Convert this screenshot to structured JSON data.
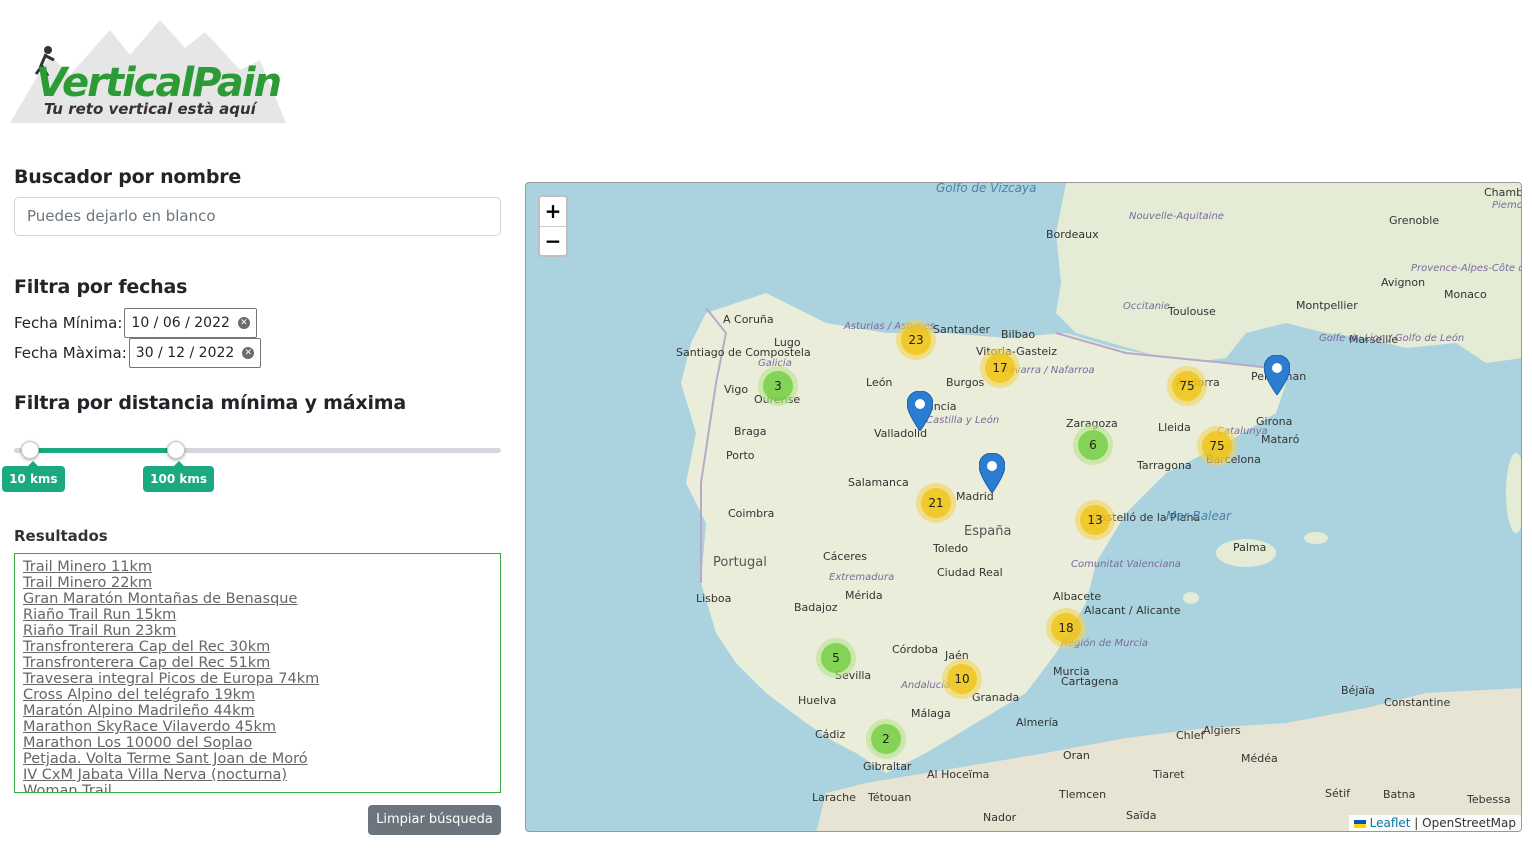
{
  "logo": {
    "brand": "VerticalPain",
    "tagline": "Tu reto vertical està aquí"
  },
  "search": {
    "title": "Buscador por nombre",
    "placeholder": "Puedes dejarlo en blanco"
  },
  "dates": {
    "title": "Filtra por fechas",
    "min_label": "Fecha Mínima:",
    "min_value": "10 / 06 / 2022",
    "max_label": "Fecha Màxima:",
    "max_value": "30 / 12 / 2022"
  },
  "distance": {
    "title": "Filtra por distancia mínima y máxima",
    "min_label": "10 kms",
    "max_label": "100 kms",
    "min_fraction": 0.033,
    "max_fraction": 0.333
  },
  "results": {
    "title": "Resultados",
    "items": [
      "Trail Minero 11km",
      "Trail Minero 22km",
      "Gran Maratón Montañas de Benasque",
      "Riaño Trail Run 15km",
      "Riaño Trail Run 23km",
      "Transfronterera Cap del Rec 30km",
      "Transfronterera Cap del Rec 51km",
      "Travesera integral Picos de Europa 74km",
      "Cross Alpino del telégrafo 19km",
      "Maratón Alpino Madrileño 44km",
      "Marathon SkyRace Vilaverdo 45km",
      "Marathon Los 10000 del Soplao",
      "Petjada. Volta Terme Sant Joan de Moró",
      "IV CxM Jabata Villa Nerva (nocturna)",
      "Woman Trail"
    ],
    "clear_label": "Limpiar búsqueda"
  },
  "map": {
    "zoom_in": "+",
    "zoom_out": "−",
    "attribution_leaflet": "Leaflet",
    "attribution_osm": "| OpenStreetMap",
    "clusters": [
      {
        "count": "23",
        "color": "yellow"
      },
      {
        "count": "17",
        "color": "yellow"
      },
      {
        "count": "3",
        "color": "green"
      },
      {
        "count": "75",
        "color": "yellow"
      },
      {
        "count": "75",
        "color": "yellow"
      },
      {
        "count": "6",
        "color": "green"
      },
      {
        "count": "21",
        "color": "yellow"
      },
      {
        "count": "13",
        "color": "yellow"
      },
      {
        "count": "18",
        "color": "yellow"
      },
      {
        "count": "5",
        "color": "green"
      },
      {
        "count": "10",
        "color": "yellow"
      },
      {
        "count": "2",
        "color": "green"
      }
    ],
    "places": [
      "Golfo de Vizcaya",
      "Bordeaux",
      "Toulouse",
      "Montpellier",
      "Marseille",
      "Monaco",
      "Avignon",
      "Grenoble",
      "Chambéry",
      "Santander",
      "Bilbao",
      "Vitoria-Gasteiz",
      "A Coruña",
      "Lugo",
      "Santiago de Compostela",
      "Vigo",
      "Ourense",
      "León",
      "Burgos",
      "Valladolid",
      "Palencia",
      "Braga",
      "Porto",
      "Zaragoza",
      "Lleida",
      "Girona",
      "Mataró",
      "Barcelona",
      "Tarragona",
      "Perpignan",
      "Andorra",
      "Salamanca",
      "Madrid",
      "España",
      "Coimbra",
      "Portugal",
      "Castelló de la Plana",
      "Mar Balear",
      "Palma",
      "Cáceres",
      "Toledo",
      "Ciudad Real",
      "Lisboa",
      "Badajoz",
      "Mérida",
      "Albacete",
      "Alacant / Alicante",
      "Córdoba",
      "Jaén",
      "Sevilla",
      "Murcia",
      "Cartagena",
      "Huelva",
      "Granada",
      "Málaga",
      "Almería",
      "Cádiz",
      "Gibraltar",
      "Algiers",
      "Oran",
      "Tiaret",
      "Chlef",
      "Médéa",
      "Béjaïa",
      "Constantine",
      "Al Hoceïma",
      "Tétouan",
      "Larache",
      "Nador",
      "Tlemcen",
      "Saïda",
      "Tebessa",
      "Batna",
      "Sétif"
    ],
    "regions": [
      "Nouvelle-Aquitaine",
      "Occitanie",
      "Provence-Alpes-Côte d'Azur",
      "Piemonte",
      "Asturias / Asturies",
      "Galicia",
      "Navarra / Nafarroa",
      "Castilla y León",
      "Catalunya",
      "Extremadura",
      "Comunitat Valenciana",
      "Andalucía",
      "Región de Murcia",
      "Golfe du Lion / Golfo de León"
    ]
  }
}
